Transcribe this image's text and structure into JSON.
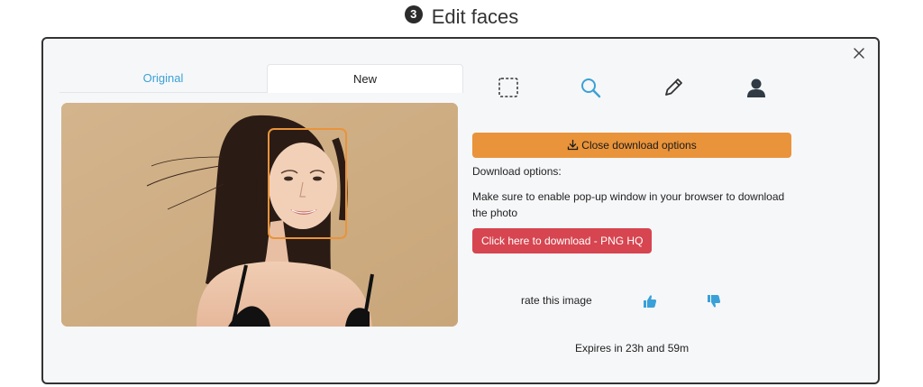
{
  "header": {
    "step_number": "3",
    "title": "Edit faces"
  },
  "tabs": [
    {
      "label": "Original",
      "active": false
    },
    {
      "label": "New",
      "active": true
    }
  ],
  "tools": [
    "selection-rect-icon",
    "search-icon",
    "pencil-icon",
    "person-icon"
  ],
  "download": {
    "close_label": "Close download options",
    "options_label": "Download options:",
    "note": "Make sure to enable pop-up window in your browser to download the photo",
    "download_button": "Click here to download - PNG HQ"
  },
  "rating": {
    "label": "rate this image"
  },
  "expires": "Expires in 23h and 59m",
  "colors": {
    "accent_blue": "#3aa1d8",
    "orange_button": "#e9933a",
    "red_button": "#d64550",
    "face_box": "#e9933a"
  }
}
